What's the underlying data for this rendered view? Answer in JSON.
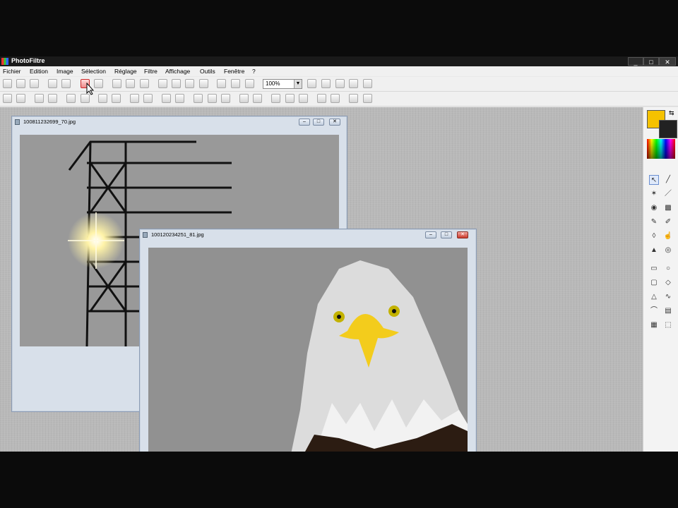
{
  "app": {
    "title": "PhotoFiltre",
    "window_buttons": [
      "_",
      "□",
      "✕"
    ]
  },
  "menu": [
    "Fichier",
    "Edition",
    "Image",
    "Sélection",
    "Réglage",
    "Filtre",
    "Affichage",
    "Outils",
    "Fenêtre",
    "?"
  ],
  "toolbar": {
    "zoom_value": "100%"
  },
  "documents": [
    {
      "name": "100811232699_70.jpg",
      "subject": "tower-sunlight-image"
    },
    {
      "name": "100120234251_81.jpg",
      "subject": "bald-eagle-image"
    }
  ],
  "palette": {
    "foreground_color": "#f5c200",
    "background_color": "#222222"
  },
  "colors": {
    "accent": "#cc2a2a",
    "window_border": "#8a9bb4"
  }
}
